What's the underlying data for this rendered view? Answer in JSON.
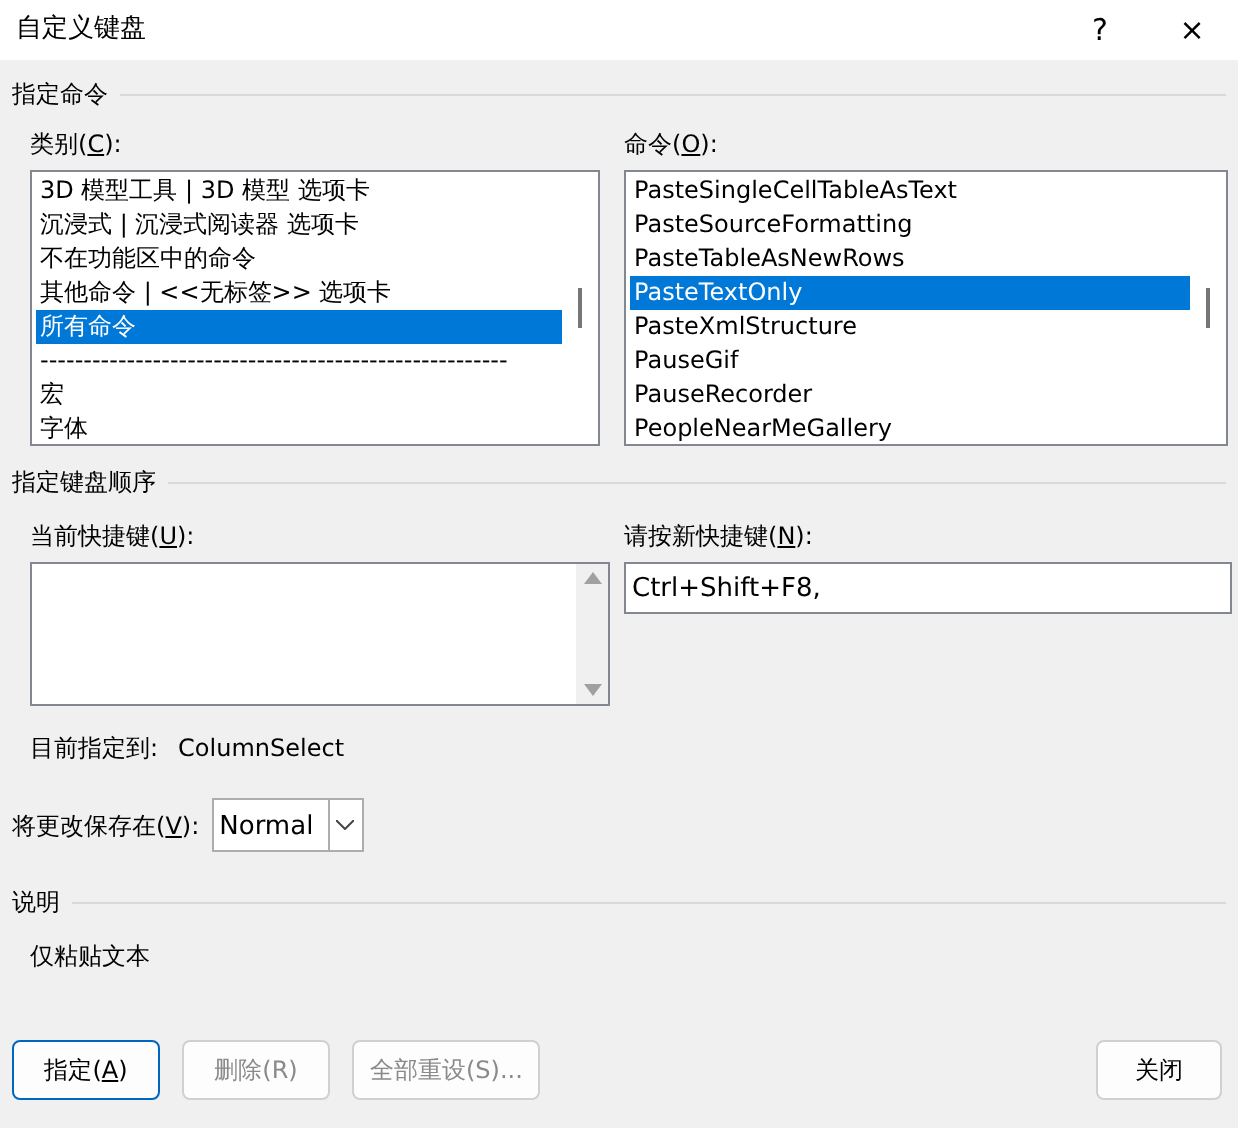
{
  "window": {
    "title": "自定义键盘",
    "help": "?",
    "close": "×"
  },
  "command_section": {
    "title": "指定命令",
    "categories": {
      "label": {
        "before": "类别(",
        "accel": "C",
        "after": "):"
      },
      "items": [
        {
          "text": "3D 模型工具 | 3D 模型 选项卡",
          "selected": false
        },
        {
          "text": "沉浸式 | 沉浸式阅读器 选项卡",
          "selected": false
        },
        {
          "text": "不在功能区中的命令",
          "selected": false
        },
        {
          "text": "其他命令 | <<无标签>> 选项卡",
          "selected": false
        },
        {
          "text": "所有命令",
          "selected": true
        },
        {
          "text": "------------------------------------------------------",
          "selected": false
        },
        {
          "text": "宏",
          "selected": false
        },
        {
          "text": "字体",
          "selected": false
        }
      ]
    },
    "commands": {
      "label": {
        "before": "命令(",
        "accel": "O",
        "after": "):"
      },
      "items": [
        {
          "text": "PasteSingleCellTableAsText",
          "selected": false
        },
        {
          "text": "PasteSourceFormatting",
          "selected": false
        },
        {
          "text": "PasteTableAsNewRows",
          "selected": false
        },
        {
          "text": "PasteTextOnly",
          "selected": true
        },
        {
          "text": "PasteXmlStructure",
          "selected": false
        },
        {
          "text": "PauseGif",
          "selected": false
        },
        {
          "text": "PauseRecorder",
          "selected": false
        },
        {
          "text": "PeopleNearMeGallery",
          "selected": false
        }
      ]
    }
  },
  "keyboard_section": {
    "title": "指定键盘顺序",
    "current_keys": {
      "label": {
        "before": "当前快捷键(",
        "accel": "U",
        "after": "):"
      }
    },
    "new_key": {
      "label": {
        "before": "请按新快捷键(",
        "accel": "N",
        "after": "):"
      },
      "value": "Ctrl+Shift+F8,"
    },
    "assigned_label": "目前指定到:",
    "assigned_value": "ColumnSelect"
  },
  "save_in": {
    "label": {
      "before": "将更改保存在(",
      "accel": "V",
      "after": "):"
    },
    "value": "Normal"
  },
  "description": {
    "title": "说明",
    "text": "仅粘贴文本"
  },
  "buttons": [
    {
      "label": {
        "before": "指定(",
        "accel": "A",
        "after": ")"
      },
      "disabled": false,
      "default": true
    },
    {
      "label": {
        "before": "删除(R)"
      },
      "disabled": true,
      "default": false
    },
    {
      "label": {
        "before": "全部重设(S)..."
      },
      "disabled": true,
      "default": false
    },
    {
      "label": {
        "before": "关闭"
      },
      "disabled": false,
      "default": false
    }
  ]
}
